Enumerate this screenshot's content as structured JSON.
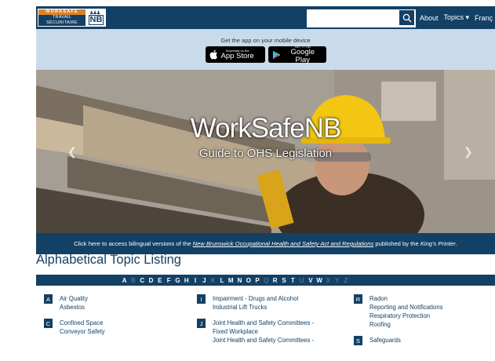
{
  "header": {
    "logo_top": "WORKSAFE",
    "logo_bottom": "TRAVAIL SÉCURITAIRE",
    "logo_nb": "NB",
    "search_placeholder": "",
    "nav": [
      "About",
      "Topics ▾",
      "Franç"
    ]
  },
  "appbar": {
    "label": "Get the app on your mobile device",
    "appstore_small": "Download on the",
    "appstore_big": "App Store",
    "googleplay_small": "GET IT ON",
    "googleplay_big": "Google Play"
  },
  "hero": {
    "title": "WorkSafeNB",
    "subtitle": "Guide to OHS Legislation"
  },
  "caption": {
    "pre": "Click here to access bilingual versions of the ",
    "link": "New Brunswick Occupational Health and Safety Act and Regulations",
    "mid": " published by the ",
    "printer": "King's Printer",
    "end": "."
  },
  "listing": {
    "title": "Alphabetical Topic Listing",
    "letters": [
      {
        "l": "A",
        "active": true
      },
      {
        "l": "B",
        "active": false
      },
      {
        "l": "C",
        "active": true
      },
      {
        "l": "D",
        "active": true
      },
      {
        "l": "E",
        "active": true
      },
      {
        "l": "F",
        "active": true
      },
      {
        "l": "G",
        "active": true
      },
      {
        "l": "H",
        "active": true
      },
      {
        "l": "I",
        "active": true
      },
      {
        "l": "J",
        "active": true
      },
      {
        "l": "K",
        "active": false
      },
      {
        "l": "L",
        "active": true
      },
      {
        "l": "M",
        "active": true
      },
      {
        "l": "N",
        "active": true
      },
      {
        "l": "O",
        "active": true
      },
      {
        "l": "P",
        "active": true
      },
      {
        "l": "Q",
        "active": false
      },
      {
        "l": "R",
        "active": true
      },
      {
        "l": "S",
        "active": true
      },
      {
        "l": "T",
        "active": true
      },
      {
        "l": "U",
        "active": false
      },
      {
        "l": "V",
        "active": true
      },
      {
        "l": "W",
        "active": true
      },
      {
        "l": "X",
        "active": false
      },
      {
        "l": "Y",
        "active": false
      },
      {
        "l": "Z",
        "active": false
      }
    ],
    "columns": [
      [
        {
          "letter": "A",
          "topics": [
            "Air Quality",
            "Asbestos"
          ]
        },
        {
          "letter": "C",
          "topics": [
            "Confined Space",
            "Conveyor Safety"
          ]
        }
      ],
      [
        {
          "letter": "I",
          "topics": [
            "Impairment - Drugs and Alcohol",
            "Industrial Lift Trucks"
          ]
        },
        {
          "letter": "J",
          "topics": [
            "Joint Health and Safety Committees -",
            "Fixed Workplace",
            "Joint Health and Safety Committees -"
          ]
        }
      ],
      [
        {
          "letter": "R",
          "topics": [
            "Radon",
            "Reporting and Notifications",
            "Respiratory Protection",
            "Roofing"
          ]
        },
        {
          "letter": "S",
          "topics": [
            "Safeguards"
          ]
        }
      ]
    ]
  }
}
